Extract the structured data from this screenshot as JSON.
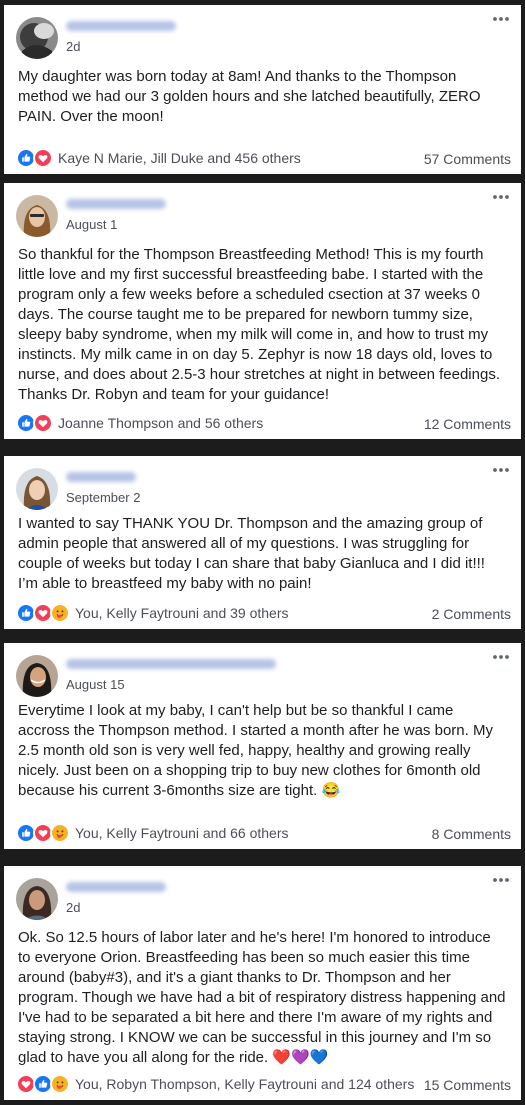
{
  "posts": [
    {
      "time": "2d",
      "text": "My daughter was born today at 8am! And thanks to the Thompson method we had our 3 golden hours and she latched beautifully, ZERO PAIN. Over the moon!",
      "reactions_text": "Kaye N Marie, Jill Duke and 456 others",
      "reaction_icons": [
        "like-icon",
        "love-icon"
      ],
      "comments": "57 Comments"
    },
    {
      "time": "August 1",
      "text": "So thankful for the Thompson Breastfeeding Method! This is my fourth little love and my first successful breastfeeding babe. I started with the program only a few weeks before a scheduled csection at 37 weeks 0 days. The course taught me to be prepared for newborn tummy size, sleepy baby syndrome, when my milk will come in, and how to trust my instincts. My milk came in on day 5. Zephyr is now 18 days old, loves to nurse, and does about 2.5-3 hour stretches at night in between feedings. Thanks Dr. Robyn and team for your guidance!",
      "reactions_text": "Joanne Thompson and 56 others",
      "reaction_icons": [
        "like-icon",
        "love-icon"
      ],
      "comments": "12 Comments"
    },
    {
      "time": "September 2",
      "text": "I wanted to say THANK YOU Dr. Thompson and the amazing group of admin people that answered all of my questions. I was struggling for couple of weeks but today I can share that baby Gianluca and I did it!!! I’m able to breastfeed my baby with no pain!",
      "reactions_text": "You, Kelly Faytrouni and 39 others",
      "reaction_icons": [
        "like-icon",
        "love-icon",
        "care-icon"
      ],
      "comments": "2 Comments"
    },
    {
      "time": "August 15",
      "text": "Everytime I look at my baby, I can't help but be so thankful I came accross the Thompson method. I started a month after he was born. My 2.5 month old son is very well fed, happy, healthy and growing really nicely. Just been on a shopping trip to buy new clothes for 6month old because his current 3-6months size are tight. 😂",
      "reactions_text": "You, Kelly Faytrouni and 66 others",
      "reaction_icons": [
        "like-icon",
        "love-icon",
        "care-icon"
      ],
      "comments": "8 Comments"
    },
    {
      "time": "2d",
      "text": "Ok. So 12.5 hours of labor later and he's here! I'm honored to introduce to everyone Orion. Breastfeeding has been so much easier this time around (baby#3), and it's a giant thanks to Dr. Thompson and her program. Though we have had a bit of respiratory distress happening and I've had to be separated a bit here and there I'm aware of my rights and staying strong. I KNOW we can be successful in this journey and I'm so glad to have you all along for the ride. ❤️💜💙",
      "reactions_text": "You, Robyn Thompson, Kelly Faytrouni and 124 others",
      "reaction_icons": [
        "love-icon",
        "like-icon",
        "care-icon"
      ],
      "comments": "15 Comments"
    }
  ],
  "colors": {
    "like": "#1877f2",
    "love": "#f33e58",
    "care": "#f7b125",
    "background": "#1c1c1c"
  }
}
